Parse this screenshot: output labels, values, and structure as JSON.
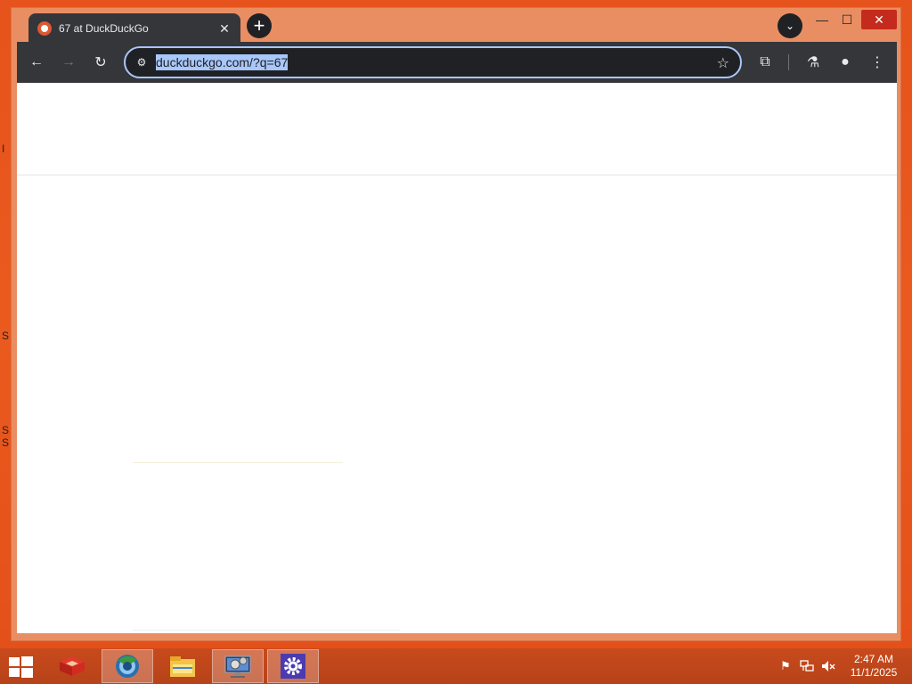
{
  "desktop": {
    "edge_text": [
      "I",
      "S",
      "S",
      "S"
    ]
  },
  "browser": {
    "tab": {
      "title": "67 at DuckDuckGo",
      "favicon": "duckduckgo-icon",
      "close_glyph": "✕"
    },
    "newtab_glyph": "+",
    "tabsearch_glyph": "⌄",
    "window_controls": {
      "minimize": "—",
      "maximize": "☐",
      "close": "✕"
    },
    "toolbar": {
      "back_glyph": "←",
      "forward_glyph": "→",
      "reload_glyph": "↻",
      "site_info_glyph": "⚙",
      "url": "duckduckgo.com/?q=67",
      "star_glyph": "☆",
      "extensions_glyph": "⧉",
      "labs_glyph": "⚗",
      "profile_glyph": "●",
      "menu_glyph": "⋮"
    }
  },
  "taskbar": {
    "apps": [
      {
        "name": "red-app-icon"
      },
      {
        "name": "browser-icon",
        "active": true
      },
      {
        "name": "file-explorer-icon"
      },
      {
        "name": "system-monitor-icon"
      },
      {
        "name": "settings-gear-icon"
      }
    ],
    "tray": {
      "flag_glyph": "⚑",
      "network_glyph": "🖧",
      "volume_glyph": "🔇"
    },
    "clock": {
      "time": "2:47 AM",
      "date": "11/1/2025"
    }
  },
  "colors": {
    "desktop": "#e6531c",
    "window_frame": "#e98e62",
    "toolbar": "#35363a",
    "omnibox_focus": "#a8c7fa",
    "close_red": "#c42b1c"
  }
}
